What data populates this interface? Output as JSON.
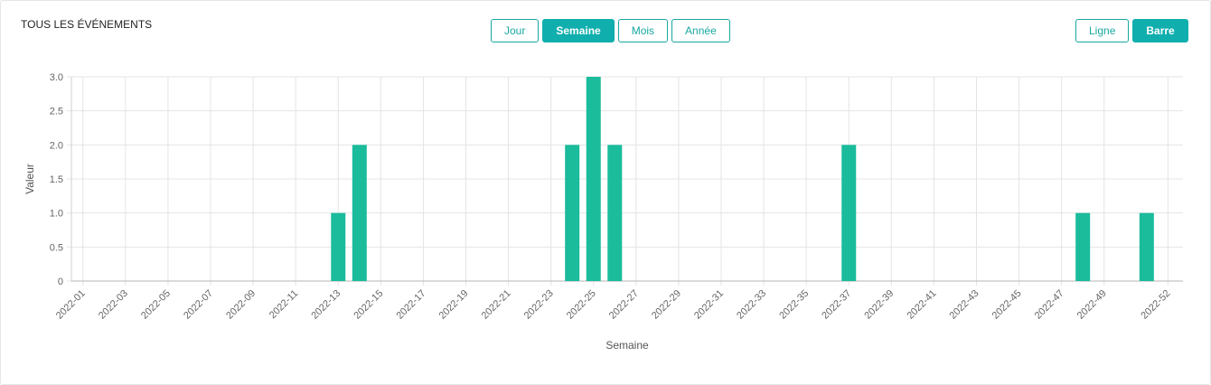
{
  "header": {
    "title": "TOUS LES ÉVÉNEMENTS"
  },
  "period_buttons": [
    {
      "label": "Jour",
      "active": false
    },
    {
      "label": "Semaine",
      "active": true
    },
    {
      "label": "Mois",
      "active": false
    },
    {
      "label": "Année",
      "active": false
    }
  ],
  "mode_buttons": [
    {
      "label": "Ligne",
      "active": false
    },
    {
      "label": "Barre",
      "active": true
    }
  ],
  "colors": {
    "accent": "#11aeae",
    "bar": "#1abc9c",
    "grid": "#e4e4e4"
  },
  "chart_data": {
    "type": "bar",
    "xlabel": "Semaine",
    "ylabel": "Valeur",
    "ylim": [
      0,
      3
    ],
    "yticks": [
      "0",
      "0.5",
      "1.0",
      "1.5",
      "2.0",
      "2.5",
      "3.0"
    ],
    "tick_labels": [
      "2022-01",
      "2022-03",
      "2022-05",
      "2022-07",
      "2022-09",
      "2022-11",
      "2022-13",
      "2022-15",
      "2022-17",
      "2022-19",
      "2022-21",
      "2022-23",
      "2022-25",
      "2022-27",
      "2022-29",
      "2022-31",
      "2022-33",
      "2022-35",
      "2022-37",
      "2022-39",
      "2022-41",
      "2022-43",
      "2022-45",
      "2022-47",
      "2022-49",
      "2022-52"
    ],
    "categories": [
      "2022-01",
      "2022-02",
      "2022-03",
      "2022-04",
      "2022-05",
      "2022-06",
      "2022-07",
      "2022-08",
      "2022-09",
      "2022-10",
      "2022-11",
      "2022-12",
      "2022-13",
      "2022-14",
      "2022-15",
      "2022-16",
      "2022-17",
      "2022-18",
      "2022-19",
      "2022-20",
      "2022-21",
      "2022-22",
      "2022-23",
      "2022-24",
      "2022-25",
      "2022-26",
      "2022-27",
      "2022-28",
      "2022-29",
      "2022-30",
      "2022-31",
      "2022-32",
      "2022-33",
      "2022-34",
      "2022-35",
      "2022-36",
      "2022-37",
      "2022-38",
      "2022-39",
      "2022-40",
      "2022-41",
      "2022-42",
      "2022-43",
      "2022-44",
      "2022-45",
      "2022-46",
      "2022-47",
      "2022-48",
      "2022-49",
      "2022-50",
      "2022-51",
      "2022-52"
    ],
    "values": [
      0,
      0,
      0,
      0,
      0,
      0,
      0,
      0,
      0,
      0,
      0,
      0,
      1,
      2,
      0,
      0,
      0,
      0,
      0,
      0,
      0,
      0,
      0,
      2,
      3,
      2,
      0,
      0,
      0,
      0,
      0,
      0,
      0,
      0,
      0,
      0,
      2,
      0,
      0,
      0,
      0,
      0,
      0,
      0,
      0,
      0,
      0,
      1,
      0,
      0,
      1,
      0
    ],
    "grid": true
  }
}
